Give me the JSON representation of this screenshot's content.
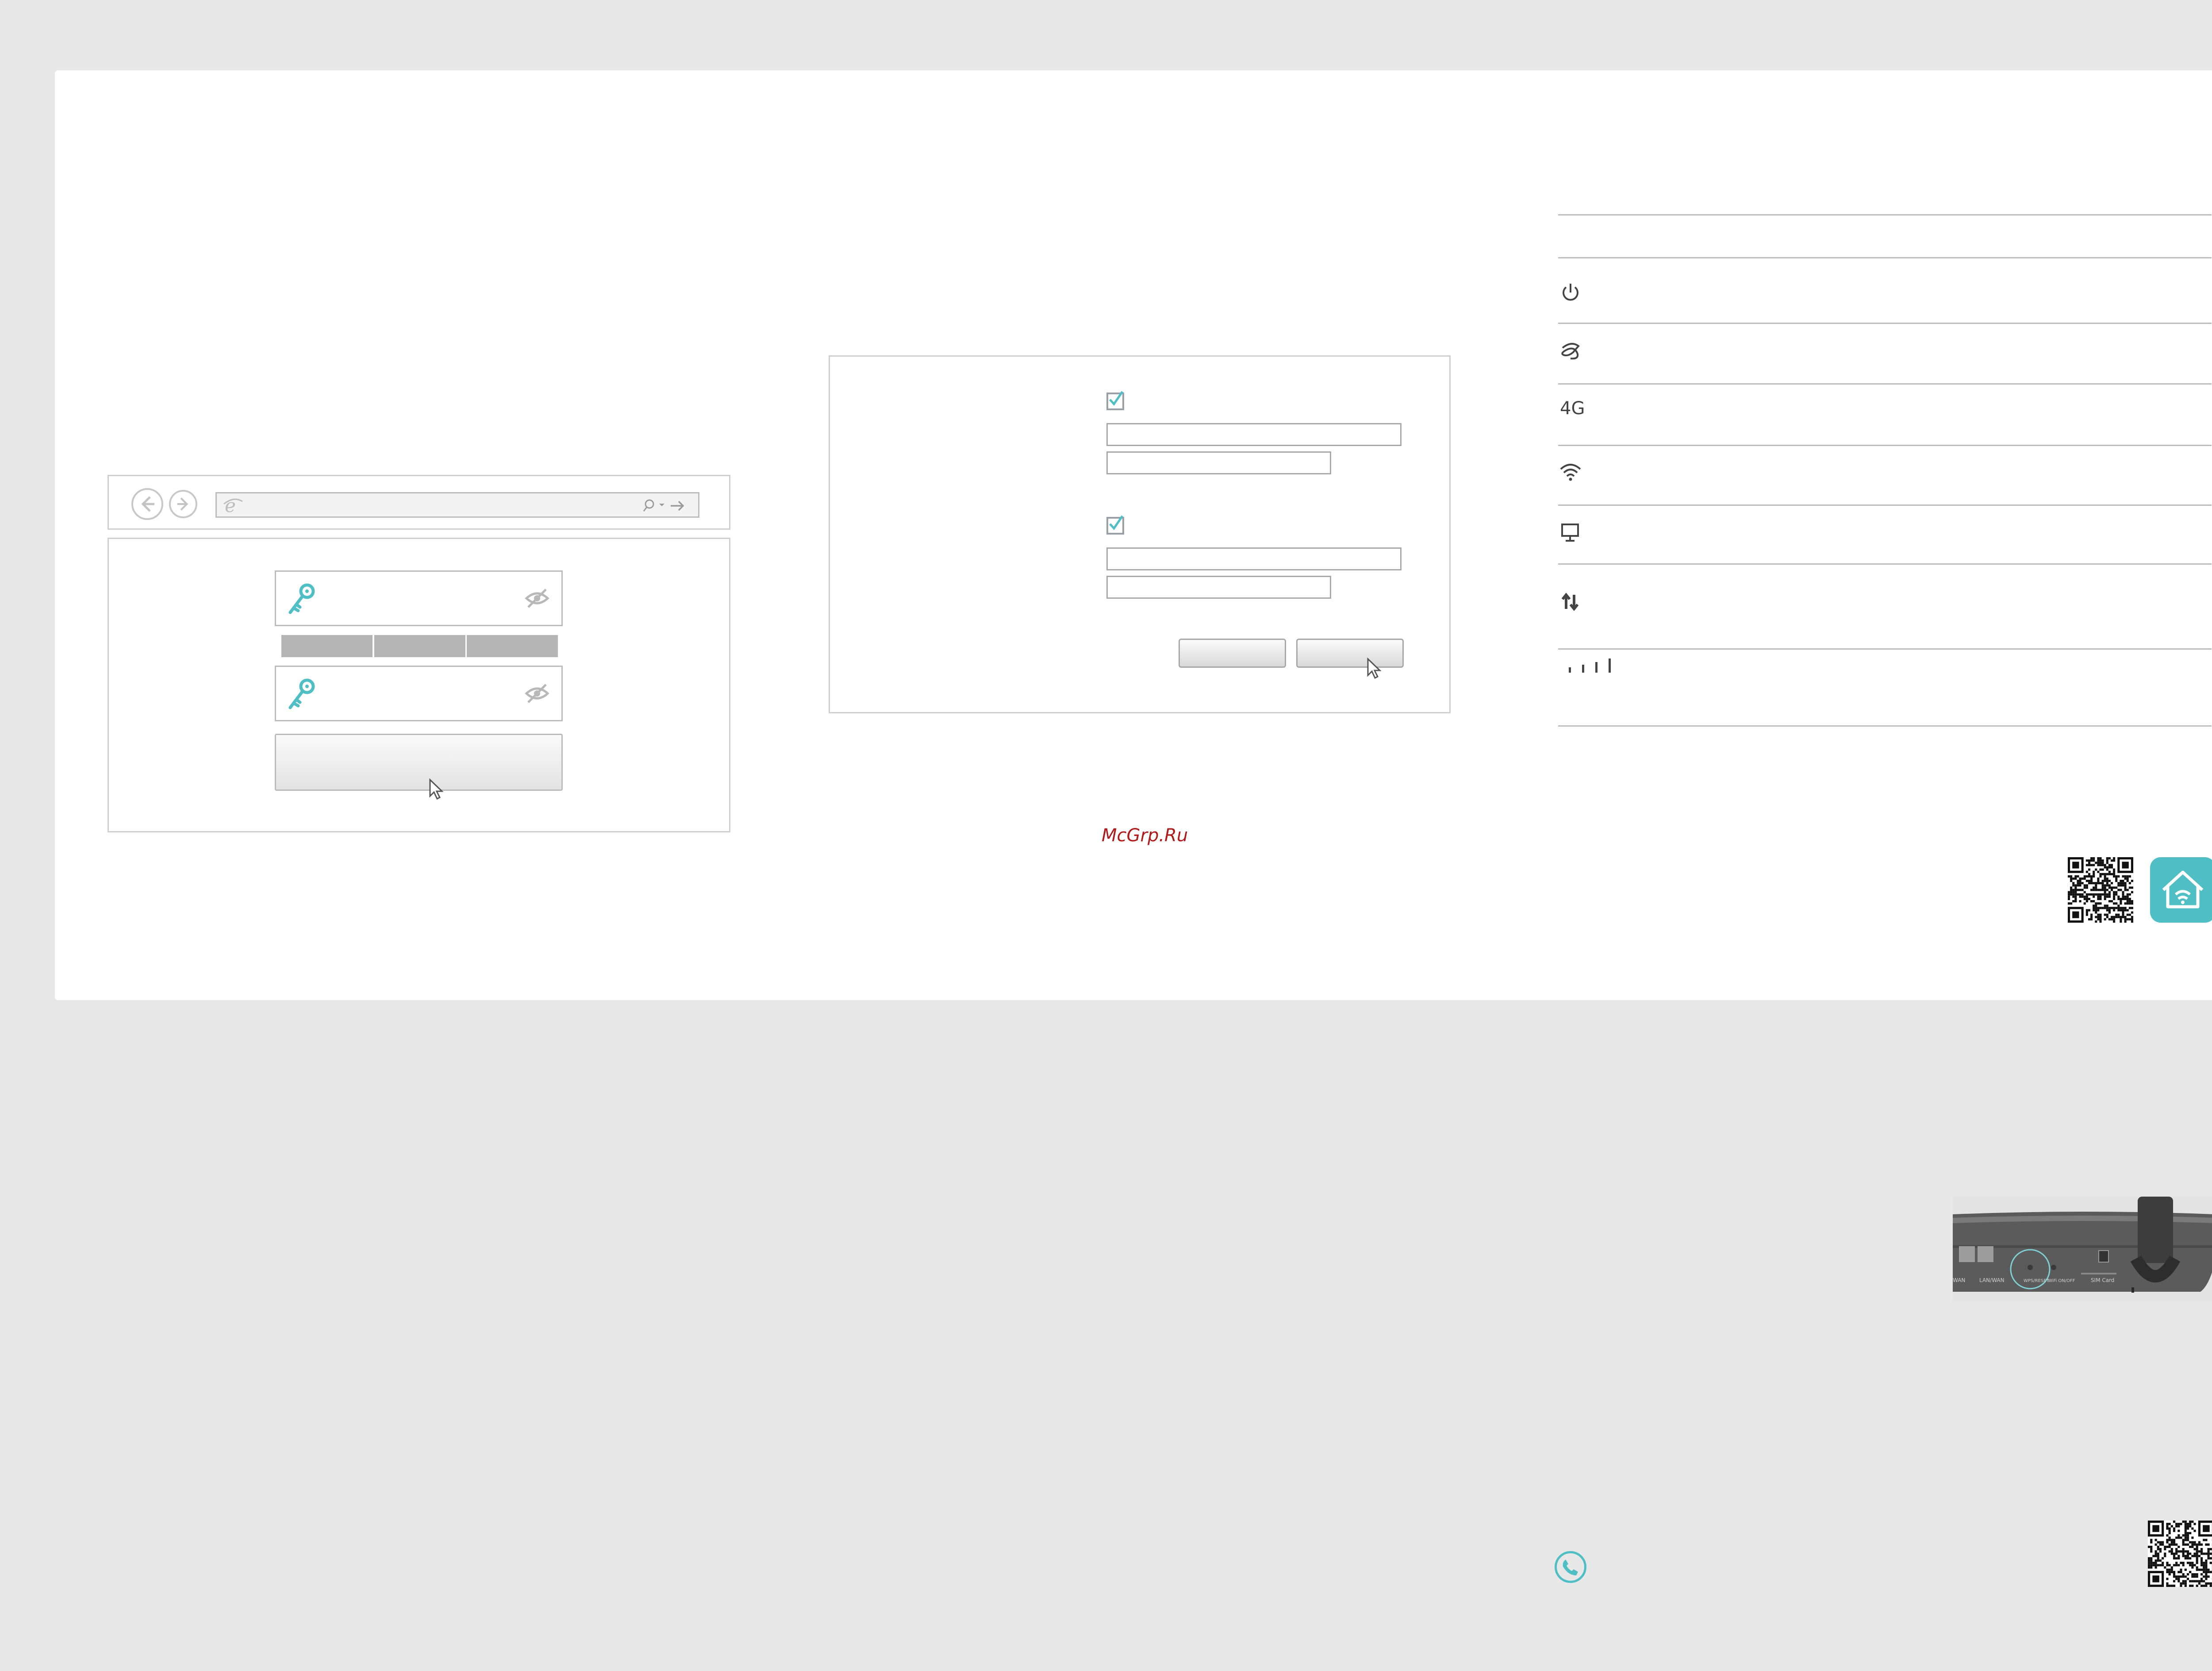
{
  "watermark": "McGrp.Ru",
  "led_table": {
    "rows": [
      {
        "icon": "power-icon"
      },
      {
        "icon": "internet-icon"
      },
      {
        "icon": "4g-icon",
        "text": "4G"
      },
      {
        "icon": "wifi-icon"
      },
      {
        "icon": "lan-icon"
      },
      {
        "icon": "wan-lan-icon"
      },
      {
        "icon": "signal-icon"
      }
    ]
  },
  "colors": {
    "accent": "#4fbfc5",
    "watermark": "#b01a1a",
    "background": "#e8e8e8"
  }
}
